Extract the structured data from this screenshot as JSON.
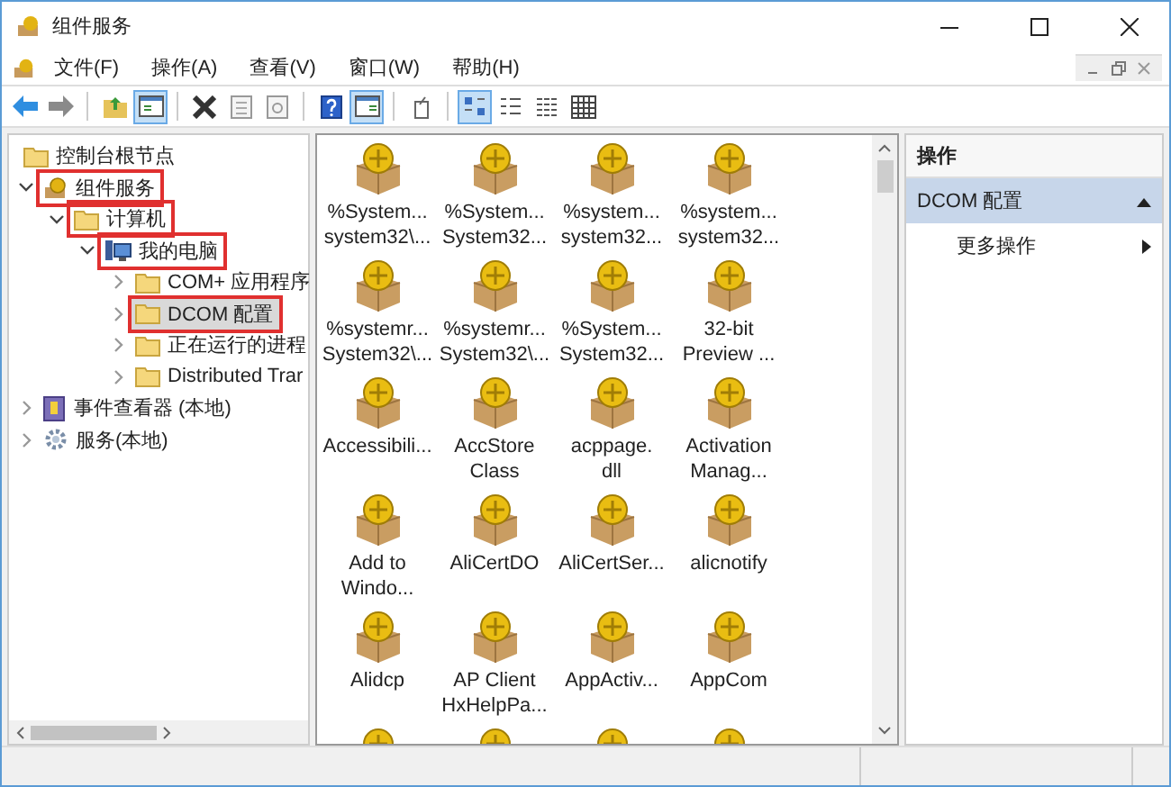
{
  "window": {
    "title": "组件服务"
  },
  "menu": [
    "文件(F)",
    "操作(A)",
    "查看(V)",
    "窗口(W)",
    "帮助(H)"
  ],
  "toolbar": [
    [
      {
        "kind": "back",
        "pressed": false
      },
      {
        "kind": "forward",
        "pressed": false
      }
    ],
    [
      {
        "kind": "up",
        "pressed": false
      },
      {
        "kind": "tree",
        "pressed": true
      }
    ],
    [
      {
        "kind": "delete",
        "pressed": false
      },
      {
        "kind": "properties",
        "pressed": false
      },
      {
        "kind": "refresh",
        "pressed": false
      }
    ],
    [
      {
        "kind": "help",
        "pressed": false
      },
      {
        "kind": "actionpane",
        "pressed": true
      }
    ],
    [
      {
        "kind": "export",
        "pressed": false
      }
    ],
    [
      {
        "kind": "largeicons",
        "pressed": true
      },
      {
        "kind": "smallicons",
        "pressed": false
      },
      {
        "kind": "list",
        "pressed": false
      },
      {
        "kind": "details",
        "pressed": false
      }
    ]
  ],
  "root": {
    "label": "控制台根节点",
    "selected": false,
    "children": [
      {
        "label": "组件服务",
        "kind": "components",
        "expanded": true,
        "selected": false,
        "annotated": true,
        "children": [
          {
            "label": "计算机",
            "kind": "folder",
            "expanded": true,
            "selected": false,
            "annotated": true,
            "children": [
              {
                "label": "我的电脑",
                "kind": "computer",
                "expanded": true,
                "selected": false,
                "annotated": true,
                "children": [
                  {
                    "label": "COM+ 应用程序",
                    "kind": "folder",
                    "expanded": false,
                    "selected": false,
                    "annotated": false
                  },
                  {
                    "label": "DCOM 配置",
                    "kind": "folder",
                    "expanded": false,
                    "selected": true,
                    "annotated": true
                  },
                  {
                    "label": "正在运行的进程",
                    "kind": "folder",
                    "expanded": false,
                    "selected": false,
                    "annotated": false
                  },
                  {
                    "label": "Distributed Trar",
                    "kind": "folder",
                    "expanded": false,
                    "selected": false,
                    "annotated": false
                  }
                ]
              }
            ]
          }
        ]
      },
      {
        "label": "事件查看器 (本地)",
        "kind": "eventlog",
        "expanded": false,
        "selected": false,
        "annotated": false
      },
      {
        "label": "服务(本地)",
        "kind": "services",
        "expanded": false,
        "selected": false,
        "annotated": false
      }
    ]
  },
  "items": [
    [
      "%System...",
      "system32\\..."
    ],
    [
      "%System...",
      "System32..."
    ],
    [
      "%system...",
      "system32..."
    ],
    [
      "%system...",
      "system32..."
    ],
    [
      "%systemr...",
      "System32\\..."
    ],
    [
      "%systemr...",
      "System32\\..."
    ],
    [
      "%System...",
      "System32..."
    ],
    [
      "32-bit",
      "Preview ..."
    ],
    [
      "Accessibili..."
    ],
    [
      "AccStore",
      "Class"
    ],
    [
      "acppage.",
      "dll"
    ],
    [
      "Activation",
      "Manag..."
    ],
    [
      "Add to",
      "Windo..."
    ],
    [
      "AliCertDO"
    ],
    [
      "AliCertSer..."
    ],
    [
      "alicnotify"
    ],
    [
      "Alidcp"
    ],
    [
      "AP Client",
      "HxHelpPa..."
    ],
    [
      "AppActiv..."
    ],
    [
      "AppCom"
    ]
  ],
  "actions": {
    "header": "操作",
    "section": {
      "label": "DCOM 配置",
      "expanded": true
    },
    "entries": [
      {
        "label": "更多操作"
      }
    ]
  }
}
